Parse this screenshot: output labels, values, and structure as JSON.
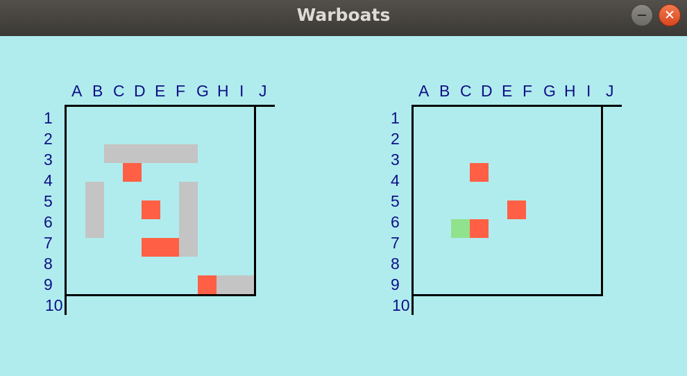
{
  "window": {
    "title": "Warboats",
    "minimize_icon": "minimize-icon",
    "close_icon": "close-icon",
    "close_glyph": "✕"
  },
  "columns": [
    "A",
    "B",
    "C",
    "D",
    "E",
    "F",
    "G",
    "H",
    "I",
    "J"
  ],
  "rows": [
    "1",
    "2",
    "3",
    "4",
    "5",
    "6",
    "7",
    "8",
    "9",
    "10"
  ],
  "colors": {
    "background": "#b0ecee",
    "ship": "#c4c4c4",
    "hit": "#ff6045",
    "miss": "#90e28c",
    "label": "#0f0f86"
  },
  "boards": [
    {
      "name": "player-board",
      "ships": [
        "C3",
        "D3",
        "E3",
        "F3",
        "G3",
        "B5",
        "B6",
        "B7",
        "G5",
        "G6",
        "G7",
        "G8",
        "I10",
        "J10"
      ],
      "hits": [
        "D4",
        "E6",
        "E8",
        "F8",
        "H10"
      ],
      "misses": []
    },
    {
      "name": "opponent-board",
      "ships": [],
      "hits": [
        "D4",
        "F6",
        "D7"
      ],
      "misses": [
        "C7"
      ]
    }
  ]
}
